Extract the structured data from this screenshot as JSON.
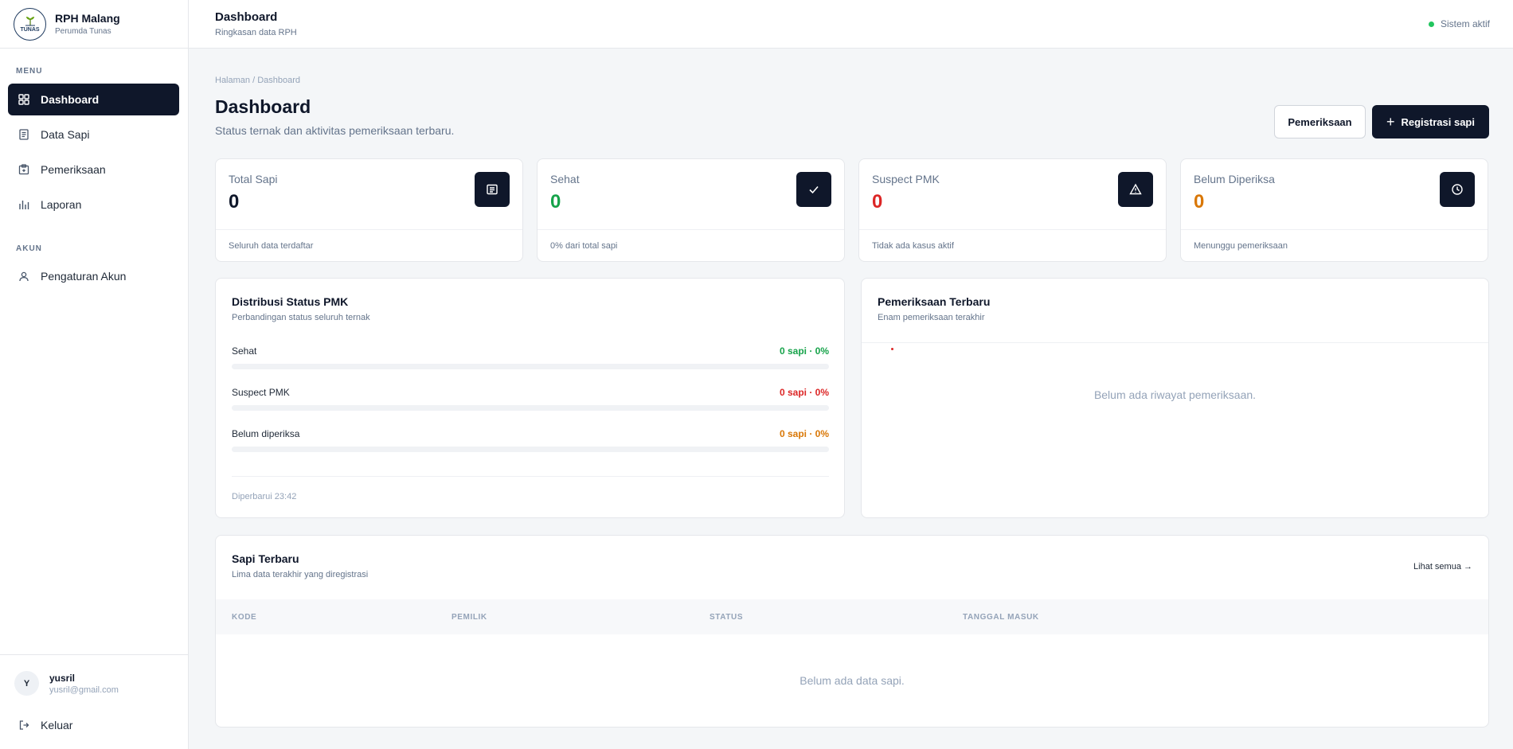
{
  "brand": {
    "name": "RPH Malang",
    "subtitle": "Perumda Tunas",
    "logo_text": "TUNAS"
  },
  "sidebar": {
    "menu_label": "MENU",
    "menu_items": [
      {
        "label": "Dashboard",
        "icon": "grid-icon",
        "active": true
      },
      {
        "label": "Data Sapi",
        "icon": "document-icon"
      },
      {
        "label": "Pemeriksaan",
        "icon": "clipboard-icon"
      },
      {
        "label": "Laporan",
        "icon": "bar-chart-icon"
      }
    ],
    "account_label": "AKUN",
    "account_items": [
      {
        "label": "Pengaturan Akun",
        "icon": "user-icon"
      }
    ]
  },
  "user": {
    "initial": "Y",
    "name": "yusril",
    "email": "yusril@gmail.com",
    "logout_label": "Keluar"
  },
  "header": {
    "title": "Dashboard",
    "subtitle": "Ringkasan data RPH",
    "status": "Sistem aktif",
    "status_color": "#22c55e"
  },
  "page": {
    "breadcrumb": "Halaman / Dashboard",
    "title": "Dashboard",
    "subtitle": "Status ternak dan aktivitas pemeriksaan terbaru.",
    "btn_secondary": "Pemeriksaan",
    "btn_primary": "Registrasi sapi"
  },
  "stats": [
    {
      "label": "Total Sapi",
      "value": "0",
      "foot": "Seluruh data terdaftar",
      "color": "#0f172a",
      "icon": "list-icon"
    },
    {
      "label": "Sehat",
      "value": "0",
      "foot": "0% dari total sapi",
      "color": "#16a34a",
      "icon": "check-icon"
    },
    {
      "label": "Suspect PMK",
      "value": "0",
      "foot": "Tidak ada kasus aktif",
      "color": "#dc2626",
      "icon": "warning-icon"
    },
    {
      "label": "Belum Diperiksa",
      "value": "0",
      "foot": "Menunggu pemeriksaan",
      "color": "#d97706",
      "icon": "clock-icon"
    }
  ],
  "distribution": {
    "title": "Distribusi Status PMK",
    "subtitle": "Perbandingan status seluruh ternak",
    "rows": [
      {
        "name": "Sehat",
        "value": "0 sapi · 0%",
        "percent": 0,
        "color": "#16a34a"
      },
      {
        "name": "Suspect PMK",
        "value": "0 sapi · 0%",
        "percent": 0,
        "color": "#dc2626"
      },
      {
        "name": "Belum diperiksa",
        "value": "0 sapi · 0%",
        "percent": 0,
        "color": "#d97706"
      }
    ],
    "updated": "Diperbarui 23:42"
  },
  "recent_checks": {
    "title": "Pemeriksaan Terbaru",
    "subtitle": "Enam pemeriksaan terakhir",
    "empty": "Belum ada riwayat pemeriksaan."
  },
  "latest_cattle": {
    "title": "Sapi Terbaru",
    "subtitle": "Lima data terakhir yang diregistrasi",
    "see_all": "Lihat semua →",
    "columns": [
      "KODE",
      "PEMILIK",
      "STATUS",
      "TANGGAL MASUK"
    ],
    "empty": "Belum ada data sapi."
  }
}
